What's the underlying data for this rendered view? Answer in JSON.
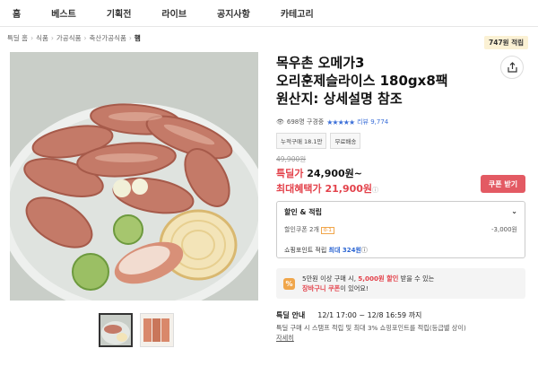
{
  "nav": [
    "홈",
    "베스트",
    "기획전",
    "라이브",
    "공지사항",
    "카테고리"
  ],
  "breadcrumb": [
    "특딜 홈",
    "식품",
    "가공식품",
    "축산가공식품",
    "햄"
  ],
  "price_badge": "747원 적립",
  "product": {
    "title_line1": "목우촌 오메가3",
    "title_line2": "오리훈제슬라이스 180gx8팩",
    "title_line3": "원산지: 상세설명 참조",
    "buyers": "698명 구경중",
    "stars": "★★★★★",
    "review_link": "리뷰 9,774",
    "rating_value": 5,
    "tag_sales": "누적구매 18.1만",
    "tag_shipping": "무료배송",
    "original_price": "49,900원",
    "price_label": "특딜가",
    "price": "24,900원~",
    "max_label": "최대혜택가",
    "max_price": "21,900원",
    "max_info": "ⓘ",
    "coupon_button": "쿠폰 받기"
  },
  "discount": {
    "header": "할인 & 적립",
    "coupon_label": "할인쿠폰 2개",
    "coupon_count": "0-1",
    "coupon_value": "-3,000원",
    "points_label": "쇼핑포인트 적립",
    "points_value": "최대 324원",
    "points_info": "ⓘ"
  },
  "promo": {
    "icon": "%",
    "text_a": "5만원 이상 구매 시, ",
    "highlight": "5,000원 할인",
    "text_b": " 받을 수 있는",
    "line2_highlight": "장바구니 쿠폰",
    "line2_rest": "이 있어요!"
  },
  "deal": {
    "label": "특딜 안내",
    "period": "12/1 17:00 ~ 12/8 16:59 까지",
    "desc": "특딜 구매 시 스탬프 적립 및 최대 3% 쇼핑포인트를 적립(등급별 상이)",
    "more": "자세히"
  },
  "colors": {
    "accent_red": "#e3424b",
    "accent_blue": "#3b6fd8",
    "coupon_button": "#e35a63"
  }
}
